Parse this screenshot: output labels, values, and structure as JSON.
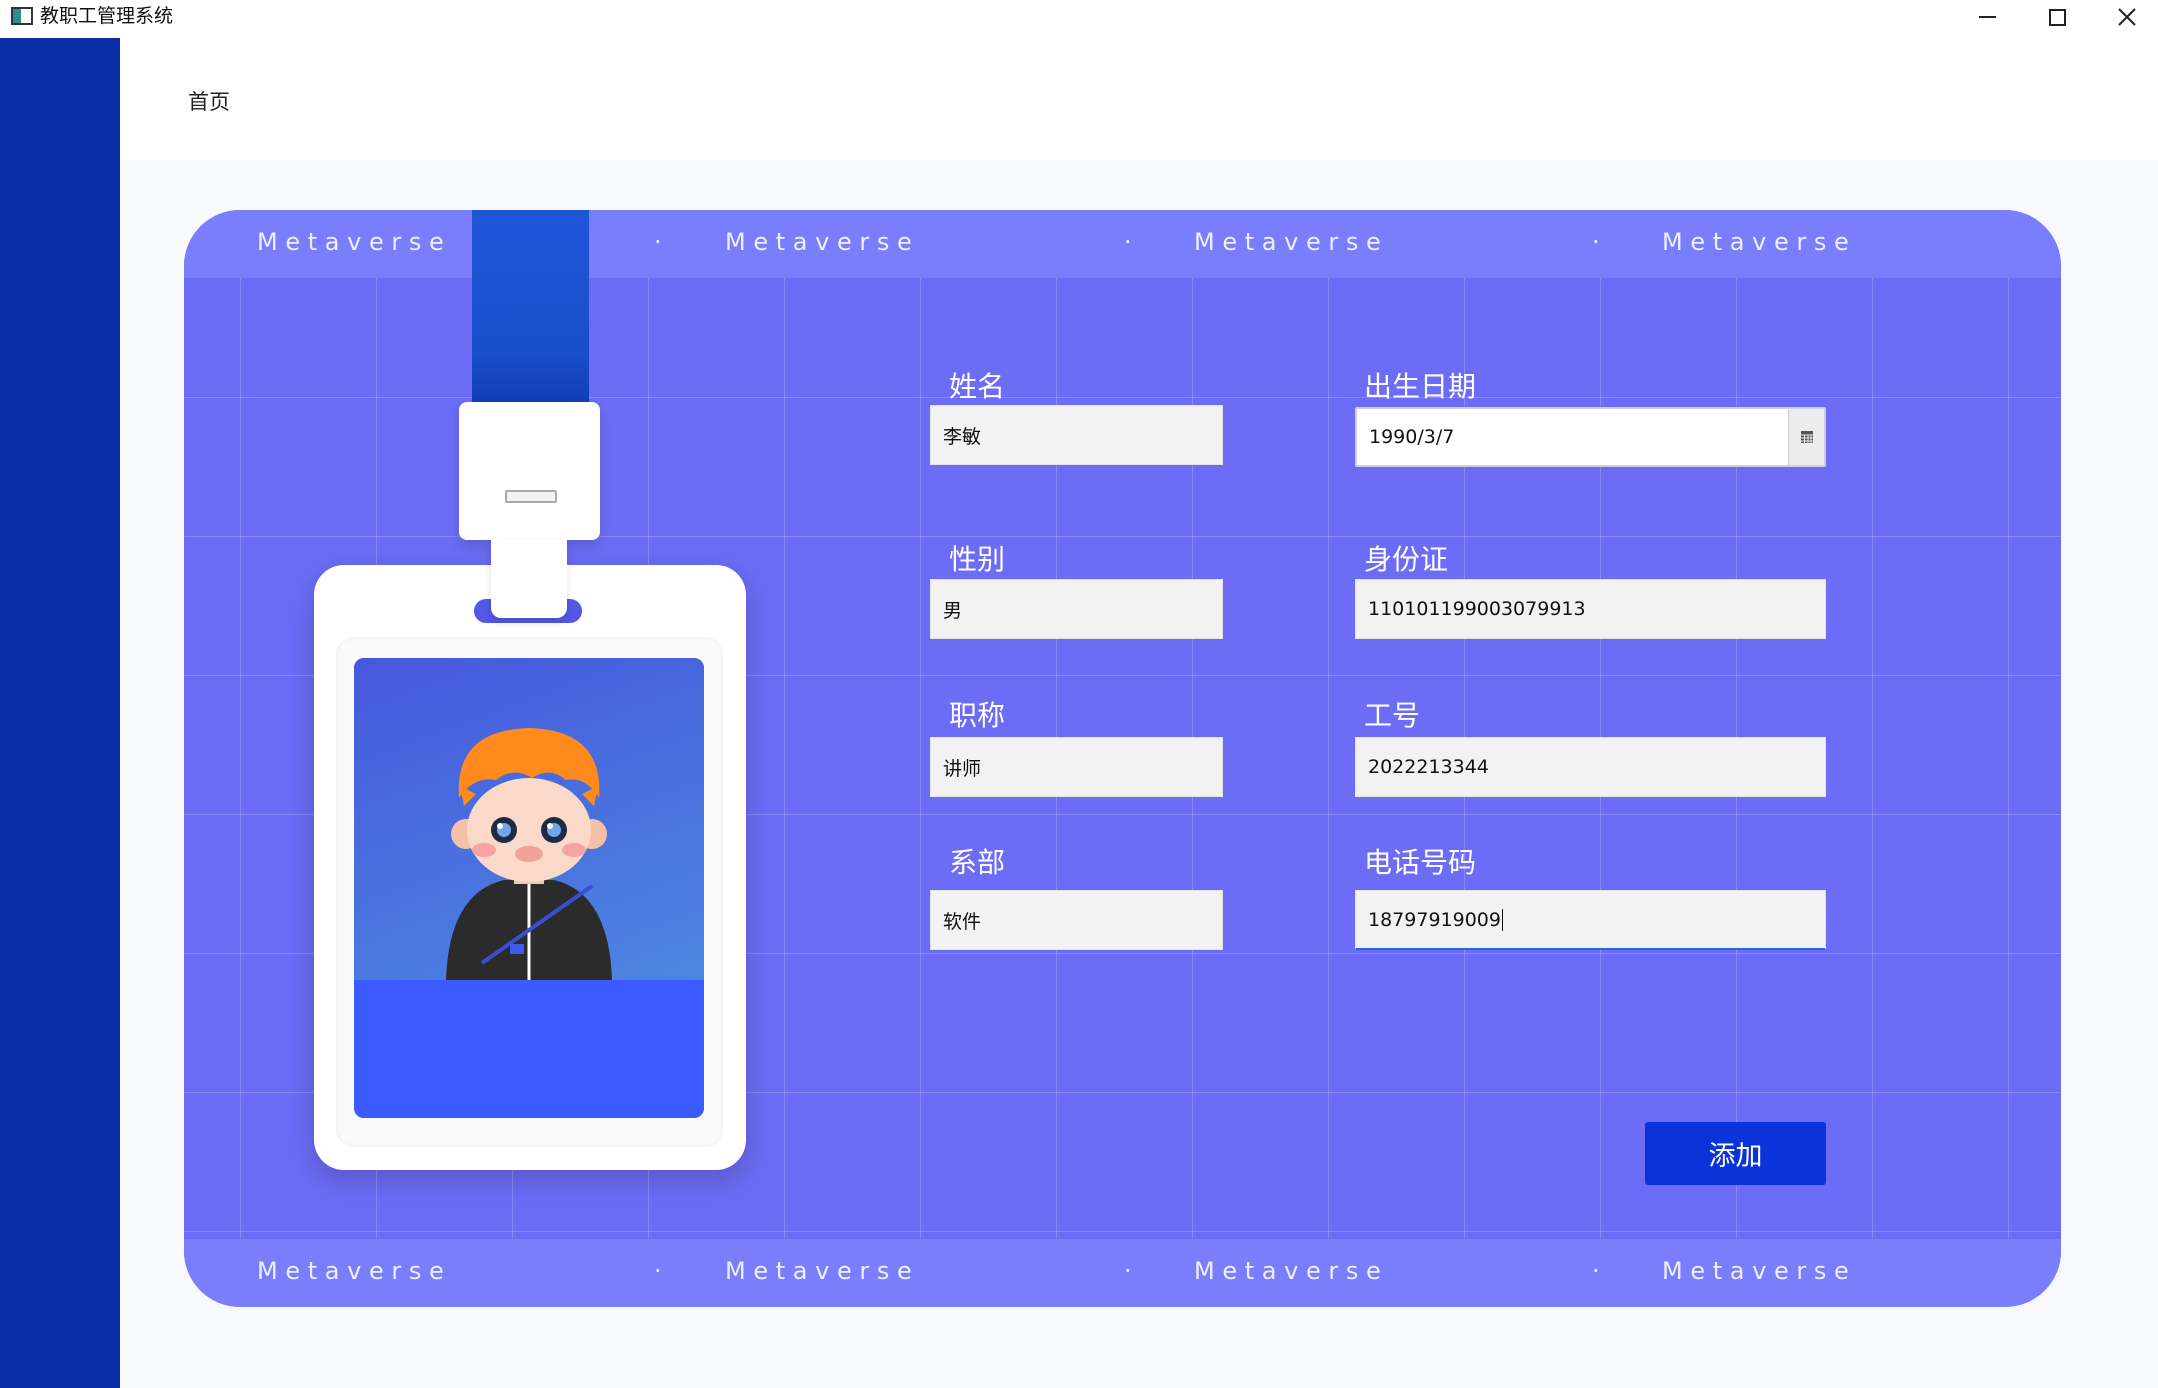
{
  "window": {
    "title": "教职工管理系统"
  },
  "header": {
    "breadcrumb": "首页"
  },
  "card": {
    "band_word": "M e t a v e r s e",
    "band_separator": "·"
  },
  "form": {
    "name_label": "姓名",
    "name_value": "李敏",
    "birth_label": "出生日期",
    "birth_value": "1990/3/7",
    "gender_label": "性别",
    "gender_value": "男",
    "id_label": "身份证",
    "id_value": "110101199003079913",
    "title_label": "职称",
    "title_value": "讲师",
    "staff_no_label": "工号",
    "staff_no_value": "2022213344",
    "dept_label": "系部",
    "dept_value": "软件",
    "phone_label": "电话号码",
    "phone_value": "18797919009",
    "submit_label": "添加"
  },
  "colors": {
    "sidebar": "#0a2ea6",
    "card": "#6c6cf6",
    "accent_button": "#0a33d9"
  },
  "icons": {
    "date_picker": "calendar-icon",
    "app": "app-icon"
  }
}
